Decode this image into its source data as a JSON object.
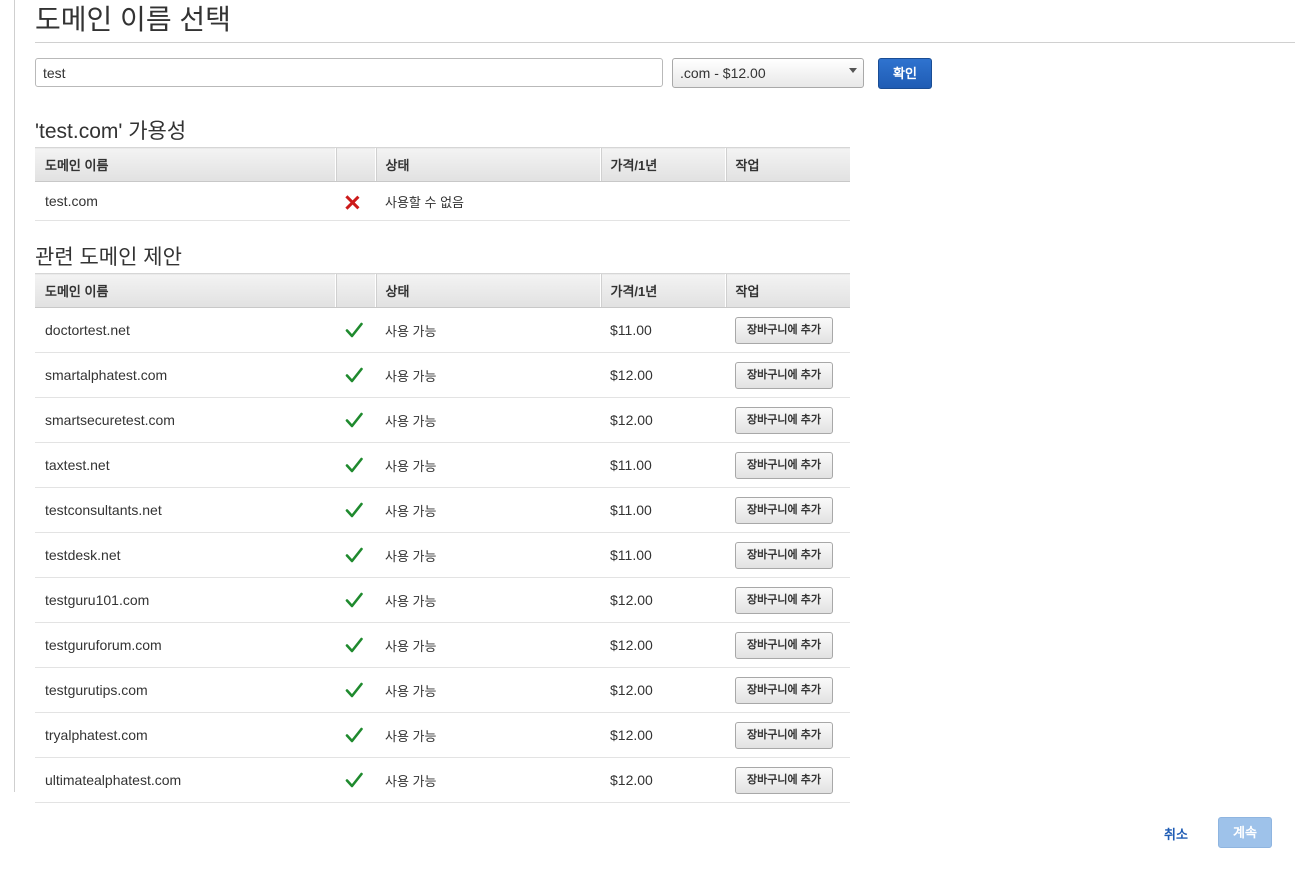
{
  "page_title": "도메인 이름 선택",
  "search": {
    "value": "test"
  },
  "tld_select": {
    "selected": ".com - $12.00"
  },
  "confirm_label": "확인",
  "availability": {
    "title": "'test.com' 가용성",
    "columns": [
      "도메인 이름",
      "",
      "상태",
      "가격/1년",
      "작업"
    ],
    "rows": [
      {
        "domain": "test.com",
        "status": "사용할 수 없음",
        "price": "",
        "icon": "x-icon"
      }
    ]
  },
  "suggestions": {
    "title": "관련 도메인 제안",
    "columns": [
      "도메인 이름",
      "",
      "상태",
      "가격/1년",
      "작업"
    ],
    "action_label": "장바구니에 추가",
    "rows": [
      {
        "domain": "doctortest.net",
        "status": "사용 가능",
        "price": "$11.00"
      },
      {
        "domain": "smartalphatest.com",
        "status": "사용 가능",
        "price": "$12.00"
      },
      {
        "domain": "smartsecuretest.com",
        "status": "사용 가능",
        "price": "$12.00"
      },
      {
        "domain": "taxtest.net",
        "status": "사용 가능",
        "price": "$11.00"
      },
      {
        "domain": "testconsultants.net",
        "status": "사용 가능",
        "price": "$11.00"
      },
      {
        "domain": "testdesk.net",
        "status": "사용 가능",
        "price": "$11.00"
      },
      {
        "domain": "testguru101.com",
        "status": "사용 가능",
        "price": "$12.00"
      },
      {
        "domain": "testguruforum.com",
        "status": "사용 가능",
        "price": "$12.00"
      },
      {
        "domain": "testgurutips.com",
        "status": "사용 가능",
        "price": "$12.00"
      },
      {
        "domain": "tryalphatest.com",
        "status": "사용 가능",
        "price": "$12.00"
      },
      {
        "domain": "ultimatealphatest.com",
        "status": "사용 가능",
        "price": "$12.00"
      }
    ]
  },
  "footer": {
    "cancel_label": "취소",
    "continue_label": "계속"
  },
  "colors": {
    "primary_blue": "#1f5cb4",
    "check_green": "#1f8a2e",
    "error_red": "#cc1a1a",
    "disabled_blue": "#9ec2ea"
  }
}
